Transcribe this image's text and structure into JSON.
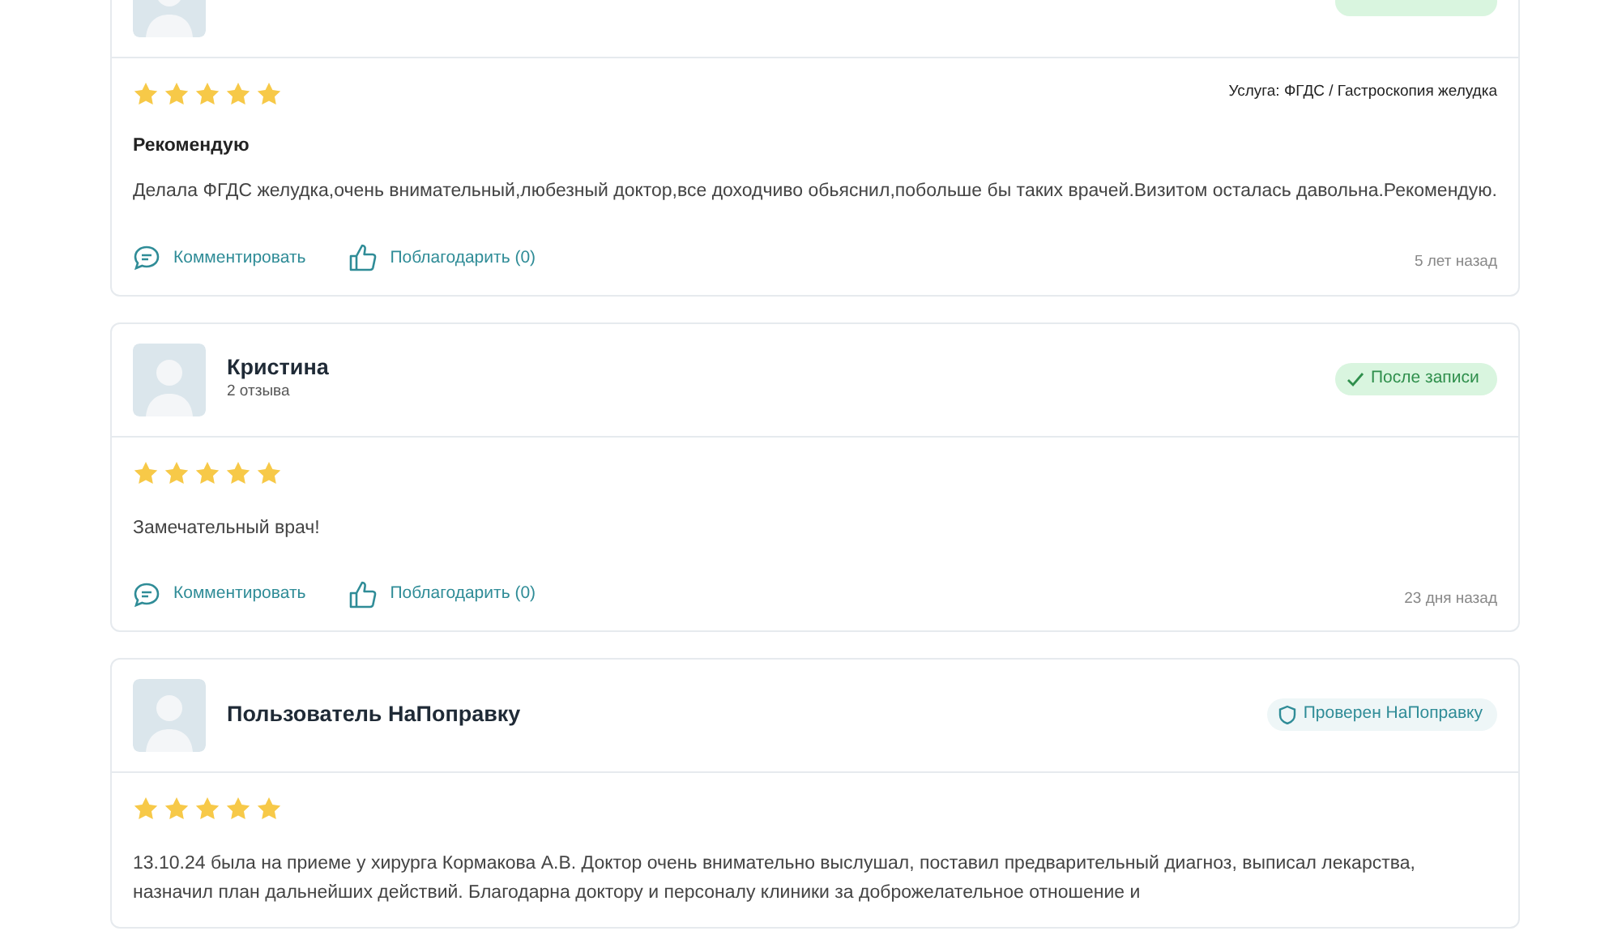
{
  "reviews": [
    {
      "badge": {
        "kind": "after_visit"
      },
      "stars": 5,
      "service": "Услуга: ФГДС / Гастроскопия желудка",
      "title": "Рекомендую",
      "text": "Делала ФГДС желудка,очень внимательный,любезный доктор,все доходчиво обьяснил,побольше бы таких врачей.Визитом осталась давольна.Рекомендую.",
      "comment": "Комментировать",
      "thank": "Поблагодарить (0)",
      "date": "5 лет назад"
    },
    {
      "author": "Кристина",
      "review_count": "2 отзыва",
      "badge": {
        "kind": "after_visit",
        "label": "После записи"
      },
      "stars": 5,
      "text": "Замечательный врач!",
      "comment": "Комментировать",
      "thank": "Поблагодарить (0)",
      "date": "23 дня назад"
    },
    {
      "author": "Пользователь НаПоправку",
      "badge": {
        "kind": "verified",
        "label": "Проверен НаПоправку"
      },
      "stars": 5,
      "text": "13.10.24 была на приеме у хирурга Кормакова А.В. Доктор очень внимательно выслушал, поставил предварительный диагноз, выписал лекарства, назначил план дальнейших действий. Благодарна доктору и персоналу клиники за доброжелательное отношение и"
    }
  ]
}
